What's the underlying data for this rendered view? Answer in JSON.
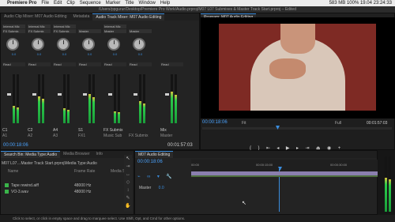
{
  "menubar": {
    "app": "Premiere Pro",
    "items": [
      "File",
      "Edit",
      "Clip",
      "Sequence",
      "Marker",
      "Title",
      "Window",
      "Help"
    ],
    "status_right": "583 MB  100%  19.04 23:24:33"
  },
  "window": {
    "title": "/Users/ppgurur/Desktop/Premiere Pro Work/Audio.prproj/M07 L07 Submixes & Master Track Start.prproj – Edited"
  },
  "mixer_tabs": [
    "Audio Clip Mixer: M07 Audio Editing",
    "Metadata",
    "Audio Track Mixer: M07 Audio Editing"
  ],
  "program_tab": "Program: M07 Audio Editing",
  "mixer": {
    "columns": [
      {
        "input": "Internal Mic",
        "output": "FX Submix",
        "knob": "0.0",
        "read": "Read",
        "name": "A1",
        "sub": "C1"
      },
      {
        "input": "Internal Mic",
        "output": "FX Submix",
        "knob": "0.0",
        "read": "Read",
        "name": "A2",
        "sub": "C2"
      },
      {
        "input": "Internal Mic",
        "output": "FX Submix",
        "knob": "0.0",
        "read": "Read",
        "name": "A3",
        "sub": "A4"
      },
      {
        "input": "",
        "output": "Master",
        "knob": "0.0",
        "read": "Read",
        "name": "FX1",
        "sub": "S1"
      },
      {
        "input": "Internal Mic",
        "output": "Master",
        "knob": "0.0",
        "read": "Read",
        "name": "Music Sub",
        "sub": "FX Submix"
      },
      {
        "input": "",
        "output": "Master",
        "knob": "0.0",
        "read": "Read",
        "name": "FX Submix",
        "sub": ""
      },
      {
        "input": "",
        "output": "",
        "knob": "",
        "read": "Read",
        "name": "Master",
        "sub": "Mix"
      }
    ],
    "timecode_left": "00:00:18:06",
    "timecode_right": "00:01:57:03"
  },
  "program": {
    "timecode": "00:00:18:06",
    "fit": "Fit",
    "quality": "Full",
    "duration": "00:01:57:03"
  },
  "project": {
    "tabs": [
      "Search Bin: Media Type:Audio",
      "Media Browser",
      "Info"
    ],
    "path": "M07 L07…Master Track Start.prproj\\Media Type:Audio",
    "columns": [
      "Name",
      "Frame Rate",
      "Media S"
    ],
    "rows": [
      {
        "name": "Tape rewind.aiff",
        "rate": "48000 Hz"
      },
      {
        "name": "VO-3.wav",
        "rate": "48000 Hz"
      }
    ]
  },
  "timeline": {
    "tab": "M07 Audio Editing",
    "timecode": "00:00:18:06",
    "ruler": [
      "00:00",
      "00:00:15:00",
      "00:00:30:00"
    ],
    "track_label": "Master",
    "track_value": "0.0"
  },
  "status_text": "Click to select, or click in empty space and drag to marquee select. Use Shift, Opt, and Cmd for other options.",
  "colors": {
    "accent": "#3a8dde",
    "meter": "#2bcc4a",
    "video_bg": "#7e2a24"
  }
}
